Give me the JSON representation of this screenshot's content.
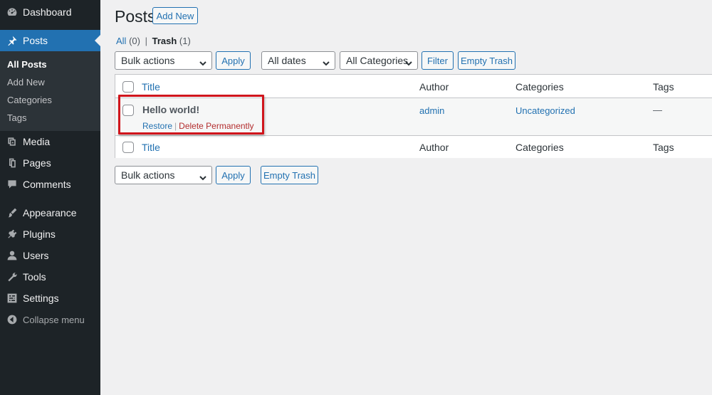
{
  "sidebar": {
    "dashboard": "Dashboard",
    "posts": "Posts",
    "submenu": {
      "all_posts": "All Posts",
      "add_new": "Add New",
      "categories": "Categories",
      "tags": "Tags"
    },
    "media": "Media",
    "pages": "Pages",
    "comments": "Comments",
    "appearance": "Appearance",
    "plugins": "Plugins",
    "users": "Users",
    "tools": "Tools",
    "settings": "Settings",
    "collapse": "Collapse menu"
  },
  "header": {
    "title": "Posts",
    "add_new": "Add New"
  },
  "views": {
    "all_label": "All",
    "all_count": "(0)",
    "separator": "|",
    "trash_label": "Trash",
    "trash_count": "(1)"
  },
  "top_nav": {
    "bulk_actions": "Bulk actions",
    "apply": "Apply",
    "dates": "All dates",
    "categories": "All Categories",
    "filter": "Filter",
    "empty_trash": "Empty Trash"
  },
  "table": {
    "columns": {
      "title": "Title",
      "author": "Author",
      "categories": "Categories",
      "tags": "Tags"
    },
    "rows": [
      {
        "title": "Hello world!",
        "restore": "Restore",
        "sep": "|",
        "delete": "Delete Permanently",
        "author": "admin",
        "category": "Uncategorized",
        "tags": "—"
      }
    ]
  },
  "bottom_nav": {
    "bulk_actions": "Bulk actions",
    "apply": "Apply",
    "empty_trash": "Empty Trash"
  },
  "colors": {
    "sidebar_bg": "#1d2327",
    "accent": "#2271b1",
    "highlight": "#d0151c",
    "delete": "#b32d2e"
  }
}
